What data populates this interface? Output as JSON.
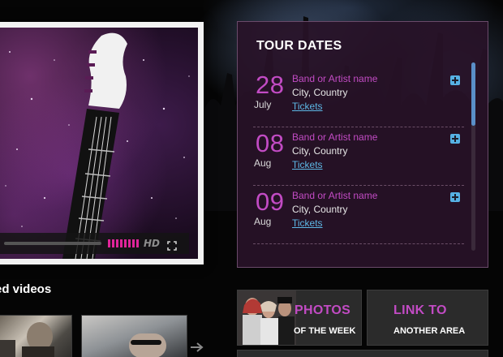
{
  "player": {
    "hd_label": "HD",
    "progress": 0.0,
    "volume_bars": 8
  },
  "tour": {
    "title": "TOUR DATES",
    "items": [
      {
        "day": "28",
        "month": "July",
        "band": "Band or Artist name",
        "city": "City, Country",
        "tickets": "Tickets"
      },
      {
        "day": "08",
        "month": "Aug",
        "band": "Band or Artist name",
        "city": "City, Country",
        "tickets": "Tickets"
      },
      {
        "day": "09",
        "month": "Aug",
        "band": "Band or Artist name",
        "city": "City, Country",
        "tickets": "Tickets"
      }
    ]
  },
  "related": {
    "title": "ed videos"
  },
  "promos": {
    "photos": {
      "heading": "PHOTOS",
      "sub": "OF THE WEEK"
    },
    "link": {
      "heading": "LINK TO",
      "sub": "ANOTHER AREA"
    }
  },
  "colors": {
    "accent": "#c24bc4",
    "link": "#5db8e6",
    "panel": "#28122a"
  },
  "icons": {
    "plus": "plus-icon",
    "fullscreen": "fullscreen-icon",
    "arrow": "arrow-right-icon"
  }
}
